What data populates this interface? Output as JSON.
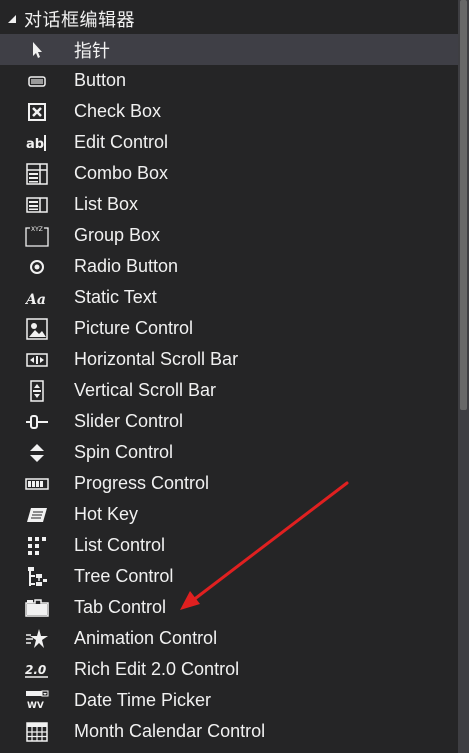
{
  "group": {
    "title": "对话框编辑器",
    "expanded": true
  },
  "items": [
    {
      "label": "指针",
      "icon": "pointer-icon",
      "selected": true
    },
    {
      "label": "Button",
      "icon": "button-icon"
    },
    {
      "label": "Check Box",
      "icon": "checkbox-icon"
    },
    {
      "label": "Edit Control",
      "icon": "edit-control-icon"
    },
    {
      "label": "Combo Box",
      "icon": "combo-box-icon"
    },
    {
      "label": "List Box",
      "icon": "list-box-icon"
    },
    {
      "label": "Group Box",
      "icon": "group-box-icon"
    },
    {
      "label": "Radio Button",
      "icon": "radio-button-icon"
    },
    {
      "label": "Static Text",
      "icon": "static-text-icon"
    },
    {
      "label": "Picture Control",
      "icon": "picture-control-icon"
    },
    {
      "label": "Horizontal Scroll Bar",
      "icon": "horizontal-scrollbar-icon"
    },
    {
      "label": "Vertical Scroll Bar",
      "icon": "vertical-scrollbar-icon"
    },
    {
      "label": "Slider Control",
      "icon": "slider-control-icon"
    },
    {
      "label": "Spin Control",
      "icon": "spin-control-icon"
    },
    {
      "label": "Progress Control",
      "icon": "progress-control-icon"
    },
    {
      "label": "Hot Key",
      "icon": "hot-key-icon"
    },
    {
      "label": "List Control",
      "icon": "list-control-icon"
    },
    {
      "label": "Tree Control",
      "icon": "tree-control-icon"
    },
    {
      "label": "Tab Control",
      "icon": "tab-control-icon"
    },
    {
      "label": "Animation Control",
      "icon": "animation-control-icon"
    },
    {
      "label": "Rich Edit 2.0 Control",
      "icon": "rich-edit-icon"
    },
    {
      "label": "Date Time Picker",
      "icon": "date-time-picker-icon"
    },
    {
      "label": "Month Calendar Control",
      "icon": "month-calendar-icon"
    }
  ],
  "annotation": {
    "color": "#e02020",
    "points_to": "Tab Control"
  },
  "colors": {
    "background": "#252526",
    "selected_row": "#3f3f46",
    "text": "#f1f1f1",
    "scrollbar_track": "#3e3e42",
    "scrollbar_thumb": "#686868"
  }
}
